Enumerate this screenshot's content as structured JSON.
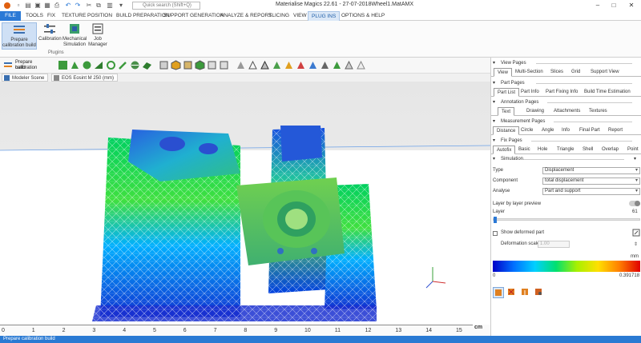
{
  "window": {
    "title": "Materialise Magics 22.61 - 27-07-2018Wheel1.MatAMX",
    "search_placeholder": "Quick search (Shift+Q)"
  },
  "menu": [
    "FILE",
    "TOOLS",
    "FIX",
    "TEXTURE",
    "POSITION",
    "BUILD PREPARATION",
    "SUPPORT GENERATION",
    "ANALYZE & REPORT",
    "SLICING",
    "VIEW",
    "PLUG INS",
    "OPTIONS & HELP"
  ],
  "ribbon": {
    "buttons": [
      {
        "line1": "Prepare",
        "line2": "calibration build"
      },
      {
        "line1": "Calibration",
        "line2": ""
      },
      {
        "line1": "Mechanical",
        "line2": "Simulation"
      },
      {
        "line1": "Job",
        "line2": "Manager"
      }
    ],
    "group_label": "Plugins"
  },
  "toolbar": {
    "first_button_line1": "Prepare calibration",
    "first_button_line2": "build"
  },
  "scene_tabs": [
    "Modeler Scene",
    "EOS Eosint M 250 (mm)"
  ],
  "ruler": {
    "ticks": [
      "0",
      "1",
      "2",
      "3",
      "4",
      "5",
      "6",
      "7",
      "8",
      "9",
      "10",
      "11",
      "12",
      "13",
      "14",
      "15"
    ],
    "unit": "cm"
  },
  "status": "Prepare calibration build",
  "panel": {
    "sections": [
      {
        "title": "View Pages",
        "tabs": [
          "View",
          "Multi-Section",
          "Slices",
          "Grid",
          "Support View"
        ],
        "selected": 0
      },
      {
        "title": "Part Pages",
        "tabs": [
          "Part List",
          "Part Info",
          "Part Fixing Info",
          "Build Time Estimation"
        ],
        "selected": 0
      },
      {
        "title": "Annotation Pages",
        "tabs": [
          "Text",
          "Drawing",
          "Attachments",
          "Textures"
        ],
        "selected": 0
      },
      {
        "title": "Measurement Pages",
        "tabs": [
          "Distance",
          "Circle",
          "Angle",
          "Info",
          "Final Part",
          "Report"
        ],
        "selected": 0
      },
      {
        "title": "Fix Pages",
        "tabs": [
          "Autofix",
          "Basic",
          "Hole",
          "Triangle",
          "Shell",
          "Overlap",
          "Point"
        ],
        "selected": 0
      }
    ],
    "simulation": {
      "title": "Simulation",
      "type_label": "Type",
      "type_value": "Displacement",
      "component_label": "Component",
      "component_value": "total displacement",
      "analyse_label": "Analyse",
      "analyse_value": "Part and support",
      "layer_preview_label": "Layer by layer preview",
      "layer_label": "Layer",
      "layer_value": "61",
      "show_deformed_label": "Show deformed part",
      "deformation_scale_label": "Deformation scale",
      "deformation_scale_value": "1.00",
      "legend_unit": "mm",
      "legend_min": "0",
      "legend_max": "0.391718"
    }
  },
  "colors": {
    "accent": "#2b79d6",
    "legend": [
      "#0000c8",
      "#0070ff",
      "#00d0ff",
      "#00e070",
      "#a8f000",
      "#ffe000",
      "#ff8000",
      "#e00000"
    ]
  }
}
